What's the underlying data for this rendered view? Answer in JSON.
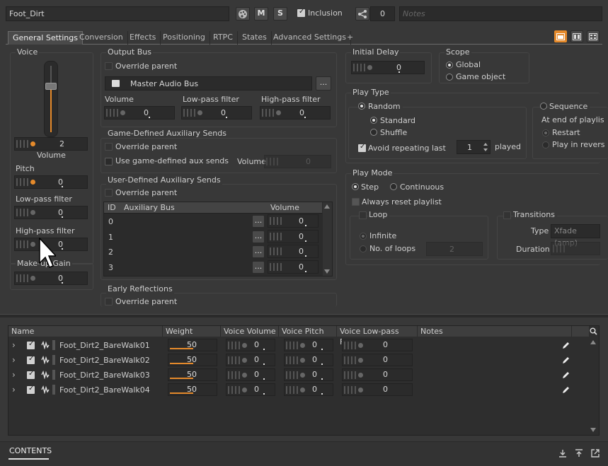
{
  "object_name": "Foot_Dirt",
  "toolbar": {
    "m_label": "M",
    "s_label": "S",
    "inclusion_label": "Inclusion",
    "share_count": "0",
    "notes_placeholder": "Notes"
  },
  "tabs": [
    "General Settings",
    "Conversion",
    "Effects",
    "Positioning",
    "RTPC",
    "States",
    "Advanced Settings",
    "+"
  ],
  "voice": {
    "title": "Voice",
    "volume_value": "2",
    "volume_label": "Volume",
    "pitch_label": "Pitch",
    "pitch_value": "0",
    "lpf_label": "Low-pass filter",
    "lpf_value": "0",
    "hpf_label": "High-pass filter",
    "hpf_value": "0",
    "makeup_label": "Make-up Gain",
    "makeup_value": "0"
  },
  "output_bus": {
    "title": "Output Bus",
    "override": "Override parent",
    "bus_name": "Master Audio Bus",
    "browse": "...",
    "volume_label": "Volume",
    "volume_value": "0",
    "lpf_label": "Low-pass filter",
    "lpf_value": "0",
    "hpf_label": "High-pass filter",
    "hpf_value": "0"
  },
  "game_aux": {
    "title": "Game-Defined Auxiliary Sends",
    "override": "Override parent",
    "use_label": "Use game-defined aux sends",
    "volume_label": "Volume",
    "volume_value": "0"
  },
  "user_aux": {
    "title": "User-Defined Auxiliary Sends",
    "override": "Override parent",
    "col_id": "ID",
    "col_bus": "Auxiliary Bus",
    "col_volume": "Volume",
    "rows": [
      {
        "id": "0",
        "value": "0"
      },
      {
        "id": "1",
        "value": "0"
      },
      {
        "id": "2",
        "value": "0"
      },
      {
        "id": "3",
        "value": "0"
      }
    ],
    "browse": "..."
  },
  "early_reflections": {
    "title": "Early Reflections",
    "override": "Override parent"
  },
  "initial_delay": {
    "title": "Initial Delay",
    "value": "0"
  },
  "scope": {
    "title": "Scope",
    "global": "Global",
    "game_object": "Game object"
  },
  "play_type": {
    "title": "Play Type",
    "random": "Random",
    "standard": "Standard",
    "shuffle": "Shuffle",
    "avoid_label": "Avoid repeating last",
    "avoid_value": "1",
    "played": "played",
    "sequence": "Sequence",
    "at_end": "At end of playlis",
    "restart": "Restart",
    "play_reverse": "Play in revers"
  },
  "play_mode": {
    "title": "Play Mode",
    "step": "Step",
    "continuous": "Continuous",
    "always_reset": "Always reset playlist",
    "loop": "Loop",
    "infinite": "Infinite",
    "no_loops": "No. of loops",
    "loops_value": "2",
    "transitions": "Transitions",
    "type_label": "Type",
    "type_value": "Xfade (amp)",
    "duration_label": "Duration"
  },
  "list": {
    "headers": [
      "Name",
      "Weight",
      "Voice Volume",
      "Voice Pitch",
      "Voice Low-pass Filter",
      "Notes"
    ],
    "rows": [
      {
        "name": "Foot_Dirt2_BareWalk01",
        "weight": "50",
        "volume": "0",
        "pitch": "0",
        "lpf": "0"
      },
      {
        "name": "Foot_Dirt2_BareWalk02",
        "weight": "50",
        "volume": "0",
        "pitch": "0",
        "lpf": "0"
      },
      {
        "name": "Foot_Dirt2_BareWalk03",
        "weight": "50",
        "volume": "0",
        "pitch": "0",
        "lpf": "0"
      },
      {
        "name": "Foot_Dirt2_BareWalk04",
        "weight": "50",
        "volume": "0",
        "pitch": "0",
        "lpf": "0"
      }
    ]
  },
  "bottom_tab": "CONTENTS",
  "colors": {
    "accent": "#e58a2b",
    "background": "#383838",
    "field": "#2b2b2b"
  },
  "icons": [
    "palette-icon",
    "share-icon",
    "layout-single-icon",
    "layout-split-icon",
    "layout-grid-icon",
    "chevron-right-icon",
    "wave-icon",
    "pencil-icon",
    "search-icon",
    "download-icon",
    "upload-icon",
    "popout-icon",
    "mouse-cursor-icon",
    "speaker-icon"
  ]
}
